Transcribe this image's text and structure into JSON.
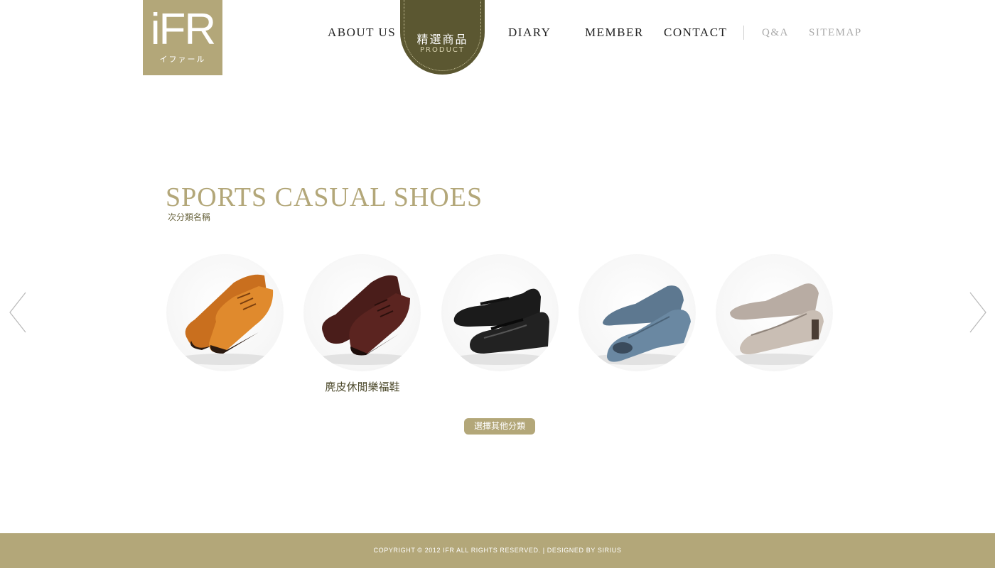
{
  "logo": {
    "text": "iFR",
    "katakana": "イファール",
    "icon": "ifr-logo"
  },
  "nav": {
    "items": [
      "ABOUT US",
      "DIARY",
      "MEMBER",
      "CONTACT"
    ],
    "active": {
      "label_cn": "精選商品",
      "label_en": "PRODUCT"
    },
    "secondary": [
      "Q&A",
      "SITEMAP"
    ]
  },
  "category": {
    "title": "SPORTS CASUAL SHOES",
    "subtitle": "次分類名稱"
  },
  "products": [
    {
      "image": "orange-oxford-shoes",
      "caption": ""
    },
    {
      "image": "brown-lace-up-shoes",
      "caption": "麂皮休閒樂福鞋"
    },
    {
      "image": "black-mary-jane-shoes",
      "caption": ""
    },
    {
      "image": "blue-peep-toe-shoes",
      "caption": ""
    },
    {
      "image": "beige-pump-shoes",
      "caption": ""
    }
  ],
  "carousel": {
    "prev_icon": "chevron-left-icon",
    "next_icon": "chevron-right-icon"
  },
  "other_button": "選擇其他分類",
  "footer": {
    "copyright": "COPYRIGHT © 2012 IFR  ALL RIGHTS RESERVED. | DESIGNED BY SIRIUS"
  },
  "colors": {
    "accent": "#b3a779",
    "active_nav": "#5b5731"
  }
}
